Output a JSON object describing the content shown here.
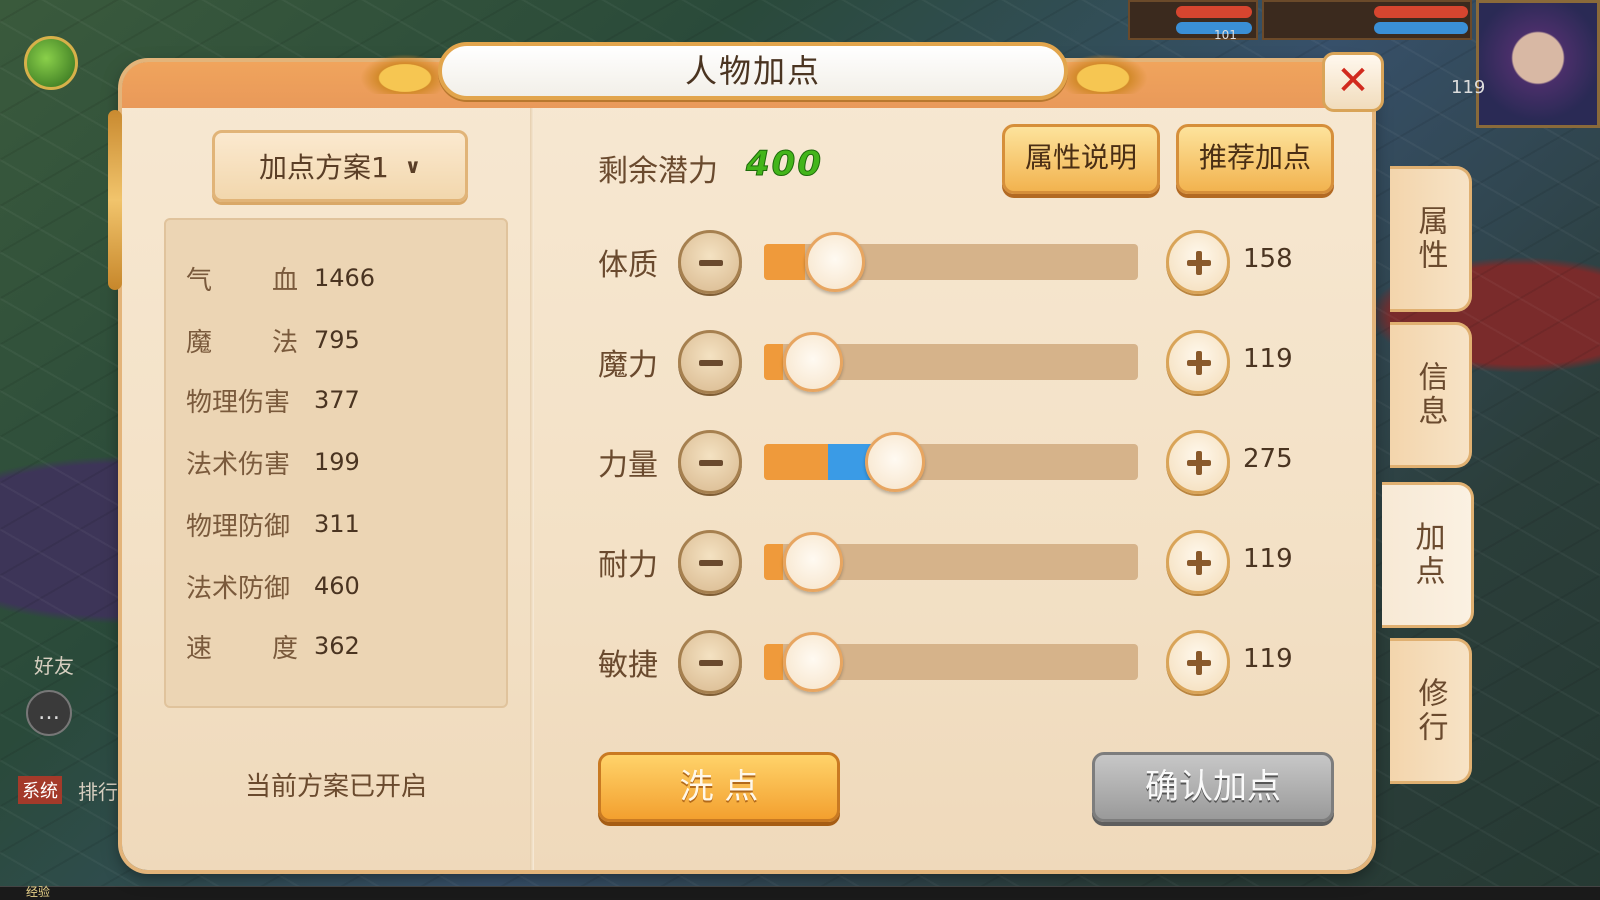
{
  "panel": {
    "title": "人物加点",
    "close_icon": "close-x-icon"
  },
  "scheme": {
    "selected": "加点方案1",
    "status": "当前方案已开启"
  },
  "stats": [
    {
      "name": "气血",
      "value": "1466"
    },
    {
      "name": "魔法",
      "value": "795"
    },
    {
      "name": "物理伤害",
      "value": "377"
    },
    {
      "name": "法术伤害",
      "value": "199"
    },
    {
      "name": "物理防御",
      "value": "311"
    },
    {
      "name": "法术防御",
      "value": "460"
    },
    {
      "name": "速度",
      "value": "362"
    }
  ],
  "potential": {
    "label": "剩余潜力",
    "value": "400"
  },
  "buttons": {
    "attr_info": "属性说明",
    "recommend": "推荐加点",
    "wash": "洗 点",
    "confirm": "确认加点"
  },
  "attributes": [
    {
      "name": "体质",
      "value": "158",
      "base_fraction": 0.11,
      "added_fraction": 0.0,
      "knob_fraction": 0.19
    },
    {
      "name": "魔力",
      "value": "119",
      "base_fraction": 0.05,
      "added_fraction": 0.0,
      "knob_fraction": 0.13
    },
    {
      "name": "力量",
      "value": "275",
      "base_fraction": 0.17,
      "added_fraction": 0.12,
      "knob_fraction": 0.35
    },
    {
      "name": "耐力",
      "value": "119",
      "base_fraction": 0.05,
      "added_fraction": 0.0,
      "knob_fraction": 0.13
    },
    {
      "name": "敏捷",
      "value": "119",
      "base_fraction": 0.05,
      "added_fraction": 0.0,
      "knob_fraction": 0.13
    }
  ],
  "tabs": [
    {
      "label": "属性",
      "active": false
    },
    {
      "label": "信息",
      "active": false
    },
    {
      "label": "加点",
      "active": true
    },
    {
      "label": "修行",
      "active": false
    }
  ],
  "hud": {
    "exp_label": "经验",
    "side_friend": "好友",
    "system_tag": "系统",
    "side_rank": "排行",
    "level_1": "101",
    "level_2": "119"
  },
  "colors": {
    "base_fill": "#ef9a3b",
    "added_fill": "#3a9be6",
    "potential": "#43b51a",
    "close": "#d12a1e"
  }
}
